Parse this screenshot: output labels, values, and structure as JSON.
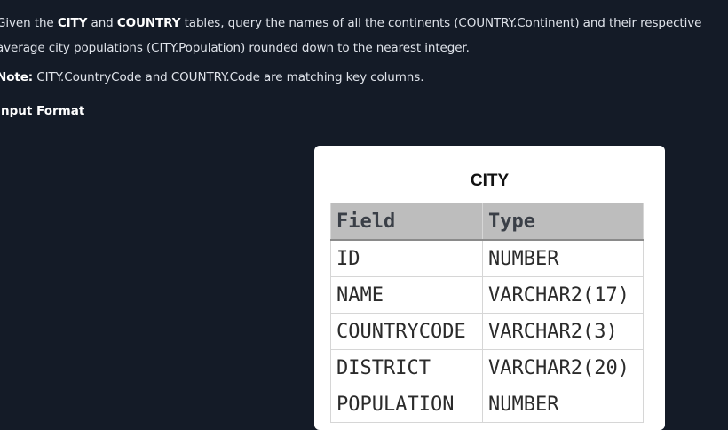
{
  "problem": {
    "intro_1": "Given the ",
    "city_kw": "CITY",
    "and_1": " and ",
    "country_kw": "COUNTRY",
    "intro_2": " tables, query the names of all the continents (COUNTRY.Continent) and their respective average city populations (CITY.Population) rounded down to the nearest integer.",
    "note_label": "Note:",
    "note_text": " CITY.CountryCode and COUNTRY.Code are matching key columns.",
    "input_format_heading": "Input Format"
  },
  "city_table": {
    "title": "CITY",
    "headers": [
      "Field",
      "Type"
    ],
    "rows": [
      {
        "field": "ID",
        "type": "NUMBER"
      },
      {
        "field": "NAME",
        "type": "VARCHAR2(17)"
      },
      {
        "field": "COUNTRYCODE",
        "type": "VARCHAR2(3)"
      },
      {
        "field": "DISTRICT",
        "type": "VARCHAR2(20)"
      },
      {
        "field": "POPULATION",
        "type": "NUMBER"
      }
    ]
  }
}
